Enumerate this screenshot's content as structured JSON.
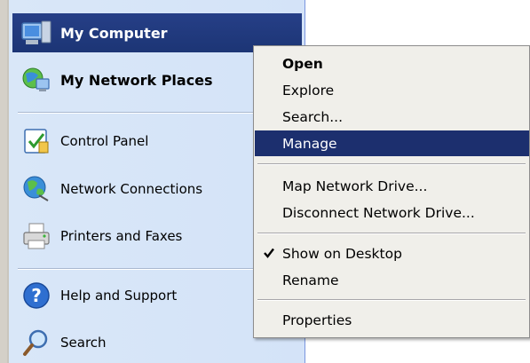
{
  "start_menu": {
    "items": [
      {
        "label": "My Computer",
        "icon": "my-computer-icon"
      },
      {
        "label": "My Network Places",
        "icon": "network-places-icon"
      },
      {
        "label": "Control Panel",
        "icon": "control-panel-icon"
      },
      {
        "label": "Network Connections",
        "icon": "network-connections-icon"
      },
      {
        "label": "Printers and Faxes",
        "icon": "printer-icon"
      },
      {
        "label": "Help and Support",
        "icon": "help-icon"
      },
      {
        "label": "Search",
        "icon": "search-icon"
      }
    ]
  },
  "context_menu": {
    "items": [
      {
        "label": "Open"
      },
      {
        "label": "Explore"
      },
      {
        "label": "Search..."
      },
      {
        "label": "Manage"
      },
      {
        "label": "Map Network Drive..."
      },
      {
        "label": "Disconnect Network Drive..."
      },
      {
        "label": "Show on Desktop",
        "checked": true
      },
      {
        "label": "Rename"
      },
      {
        "label": "Properties"
      }
    ]
  },
  "colors": {
    "highlight": "#1c2f6e",
    "start_panel": "#d4e3f8",
    "menu_bg": "#f0efea"
  }
}
